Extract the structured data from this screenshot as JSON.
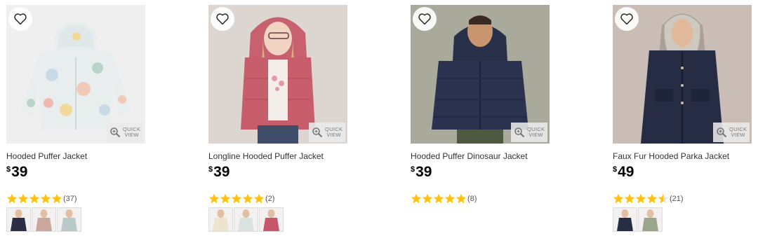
{
  "products": [
    {
      "title": "Hooded Puffer Jacket",
      "currency": "$",
      "price": "39",
      "rating": 5,
      "reviews": "(37)",
      "quick_view": [
        "QUICK",
        "VIEW"
      ],
      "swatch_colors": [
        "#2a2f45",
        "#c9a79a",
        "#b9c9c9"
      ]
    },
    {
      "title": "Longline Hooded Puffer Jacket",
      "currency": "$",
      "price": "39",
      "rating": 5,
      "reviews": "(2)",
      "quick_view": [
        "QUICK",
        "VIEW"
      ],
      "swatch_colors": [
        "#ece4cf",
        "#d9e3df",
        "#c8566a"
      ]
    },
    {
      "title": "Hooded Puffer Dinosaur Jacket",
      "currency": "$",
      "price": "39",
      "rating": 5,
      "reviews": "(8)",
      "quick_view": [
        "QUICK",
        "VIEW"
      ],
      "swatch_colors": []
    },
    {
      "title": "Faux Fur Hooded Parka Jacket",
      "currency": "$",
      "price": "49",
      "rating": 4.5,
      "reviews": "(21)",
      "quick_view": [
        "QUICK",
        "VIEW"
      ],
      "swatch_colors": [
        "#262e45",
        "#9aa68a"
      ]
    }
  ],
  "colors": {
    "star": "#ffc20e",
    "heart": "#222222"
  }
}
